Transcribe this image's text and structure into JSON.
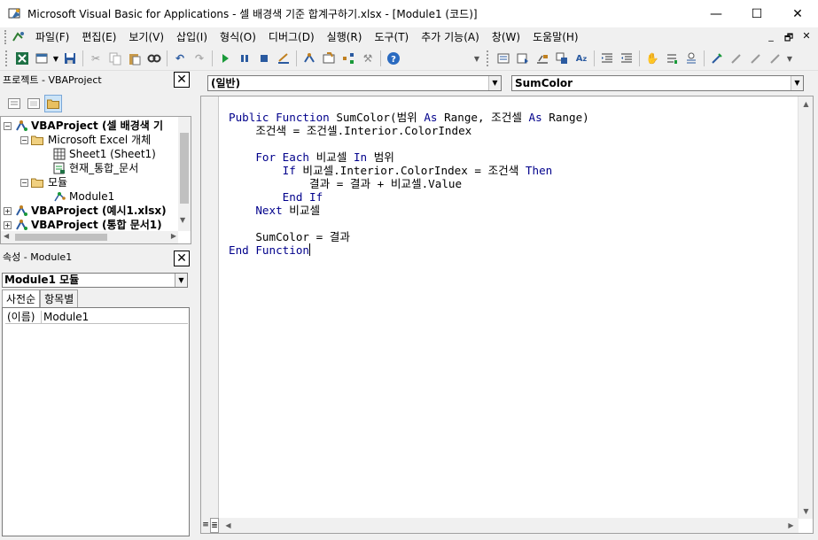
{
  "window": {
    "title": "Microsoft Visual Basic for Applications - 셀 배경색 기준 합계구하기.xlsx - [Module1 (코드)]",
    "minimize_glyph": "—",
    "maximize_glyph": "☐",
    "close_glyph": "✕"
  },
  "menu": {
    "items": [
      "파일(F)",
      "편집(E)",
      "보기(V)",
      "삽입(I)",
      "형식(O)",
      "디버그(D)",
      "실행(R)",
      "도구(T)",
      "추가 기능(A)",
      "창(W)",
      "도움말(H)"
    ],
    "mdi_min": "_",
    "mdi_restore": "🗗",
    "mdi_close": "✕"
  },
  "project_pane": {
    "title": "프로젝트 - VBAProject",
    "close_glyph": "✕",
    "tree": {
      "proj1": "VBAProject (셀 배경색 기",
      "excel_objects": "Microsoft Excel 개체",
      "sheet1": "Sheet1 (Sheet1)",
      "thisworkbook": "현재_통합_문서",
      "modules": "모듈",
      "module1": "Module1",
      "proj2": "VBAProject (예시1.xlsx)",
      "proj3": "VBAProject (통합 문서1)"
    }
  },
  "properties_pane": {
    "title": "속성 - Module1",
    "close_glyph": "✕",
    "object_select": "Module1 모듈",
    "tabs": [
      "사전순",
      "항목별"
    ],
    "rows": [
      {
        "name": "(이름)",
        "value": "Module1"
      }
    ]
  },
  "code_window": {
    "object_combo": "(일반)",
    "procedure_combo": "SumColor",
    "lines": [
      [
        {
          "t": "Public Function ",
          "k": true
        },
        {
          "t": "SumColor(범위 "
        },
        {
          "t": "As ",
          "k": true
        },
        {
          "t": "Range, 조건셀 "
        },
        {
          "t": "As ",
          "k": true
        },
        {
          "t": "Range)"
        }
      ],
      [
        {
          "t": "    조건색 = 조건셀.Interior.ColorIndex"
        }
      ],
      [
        {
          "t": ""
        }
      ],
      [
        {
          "t": "    "
        },
        {
          "t": "For Each ",
          "k": true
        },
        {
          "t": "비교셀 "
        },
        {
          "t": "In ",
          "k": true
        },
        {
          "t": "범위"
        }
      ],
      [
        {
          "t": "        "
        },
        {
          "t": "If ",
          "k": true
        },
        {
          "t": "비교셀.Interior.ColorIndex = 조건색 "
        },
        {
          "t": "Then",
          "k": true
        }
      ],
      [
        {
          "t": "            결과 = 결과 + 비교셀.Value"
        }
      ],
      [
        {
          "t": "        "
        },
        {
          "t": "End If",
          "k": true
        }
      ],
      [
        {
          "t": "    "
        },
        {
          "t": "Next ",
          "k": true
        },
        {
          "t": "비교셀"
        }
      ],
      [
        {
          "t": ""
        }
      ],
      [
        {
          "t": "    SumColor = 결과"
        }
      ],
      [
        {
          "t": "End Function",
          "k": true
        }
      ]
    ]
  }
}
